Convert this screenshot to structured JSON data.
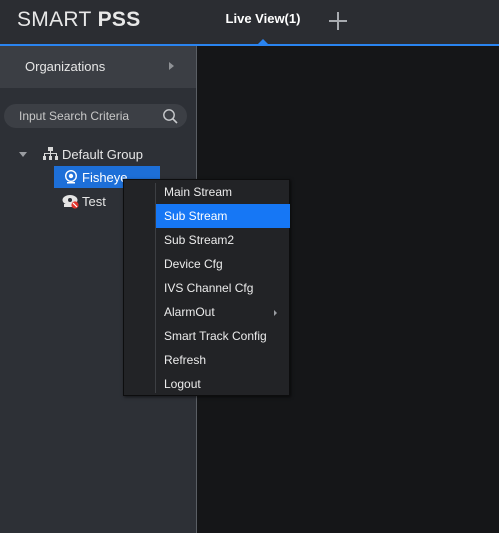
{
  "header": {
    "brand_light": "SMART",
    "brand_bold": "PSS",
    "tab_label": "Live View(1)",
    "add_tab_icon": "plus-icon",
    "accent_color": "#2a84f0"
  },
  "sidebar": {
    "organizations_label": "Organizations",
    "search": {
      "placeholder": "Input Search Criteria",
      "value": ""
    },
    "tree": {
      "group_label": "Default Group",
      "devices": [
        {
          "label": "Fisheye",
          "icon": "fisheye-camera-icon",
          "selected": true
        },
        {
          "label": "Test",
          "icon": "offline-device-icon",
          "selected": false
        }
      ]
    }
  },
  "context_menu": {
    "items": [
      {
        "label": "Main Stream",
        "selected": false
      },
      {
        "label": "Sub Stream",
        "selected": true
      },
      {
        "label": "Sub Stream2",
        "selected": false
      },
      {
        "label": "Device Cfg",
        "selected": false
      },
      {
        "label": "IVS Channel Cfg",
        "selected": false
      },
      {
        "label": "AlarmOut",
        "selected": false,
        "has_submenu": true
      },
      {
        "label": "Smart Track Config",
        "selected": false
      },
      {
        "label": "Refresh",
        "selected": false
      },
      {
        "label": "Logout",
        "selected": false
      }
    ],
    "selected_color": "#1677f5"
  }
}
